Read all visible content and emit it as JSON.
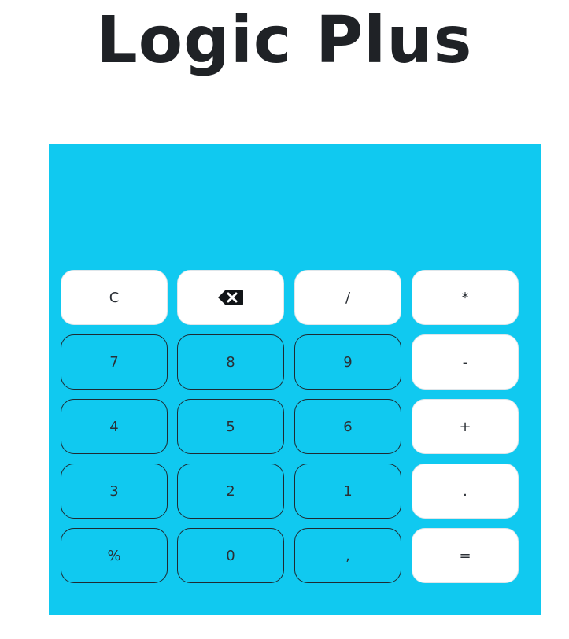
{
  "app": {
    "title": "Logic Plus"
  },
  "display": {
    "value": ""
  },
  "keys": {
    "clear": "C",
    "backspace_icon": "backspace-icon",
    "divide": "/",
    "multiply": "*",
    "seven": "7",
    "eight": "8",
    "nine": "9",
    "minus": "-",
    "four": "4",
    "five": "5",
    "six": "6",
    "plus": "+",
    "three": "3",
    "two": "2",
    "one": "1",
    "dot": ".",
    "percent": "%",
    "zero": "0",
    "comma": ",",
    "equals": "="
  },
  "colors": {
    "panel": "#10c9f0",
    "title": "#1f2226",
    "key_light": "#ffffff"
  }
}
